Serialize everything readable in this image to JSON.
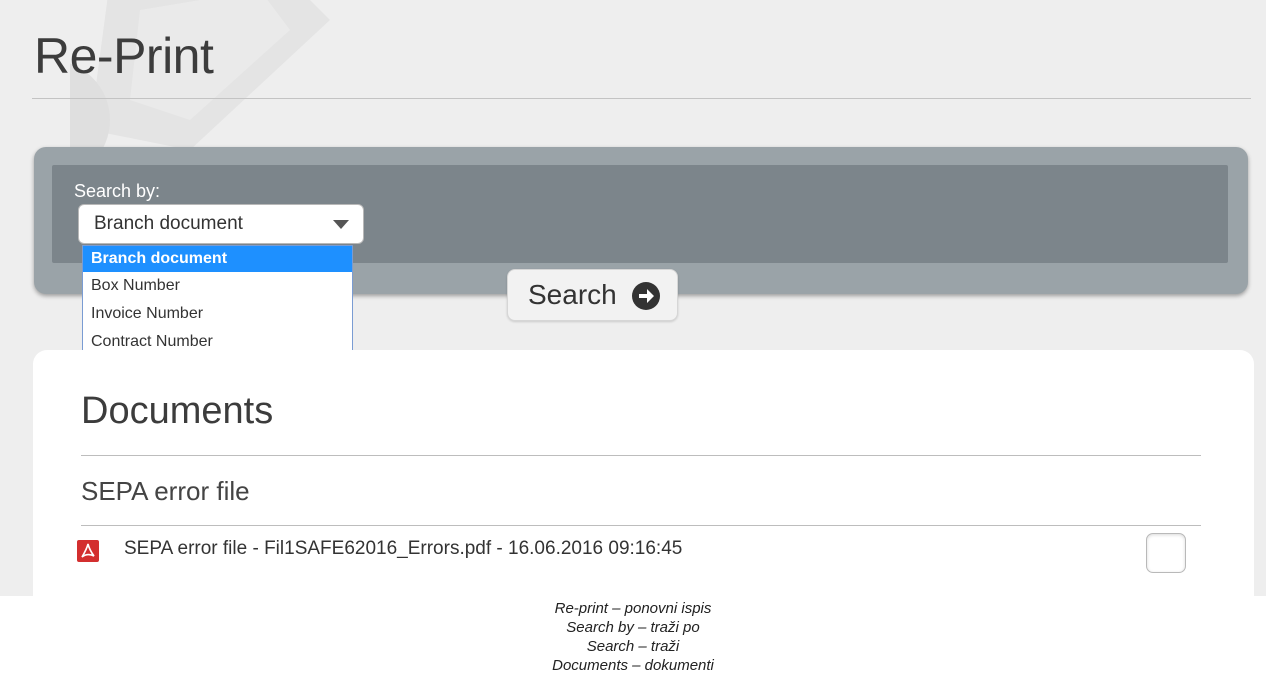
{
  "page": {
    "title": "Re-Print"
  },
  "search": {
    "label": "Search by:",
    "selected": "Branch document",
    "options": [
      "Branch document",
      "Box Number",
      "Invoice Number",
      "Contract Number"
    ],
    "button_label": "Search"
  },
  "documents": {
    "title": "Documents",
    "sections": [
      {
        "title": "SEPA error file",
        "items": [
          {
            "label": "SEPA error file - Fil1SAFE62016_Errors.pdf - 16.06.2016 09:16:45",
            "icon": "pdf-icon",
            "checked": false
          }
        ]
      }
    ]
  },
  "captions": [
    "Re-print – ponovni ispis",
    "Search by – traži po",
    "Search – traži",
    "Documents  – dokumenti"
  ],
  "colors": {
    "accent": "#1e90ff",
    "panel": "#9aa3a8",
    "panel_inner": "#7c858b",
    "pdf": "#d32f2f"
  }
}
